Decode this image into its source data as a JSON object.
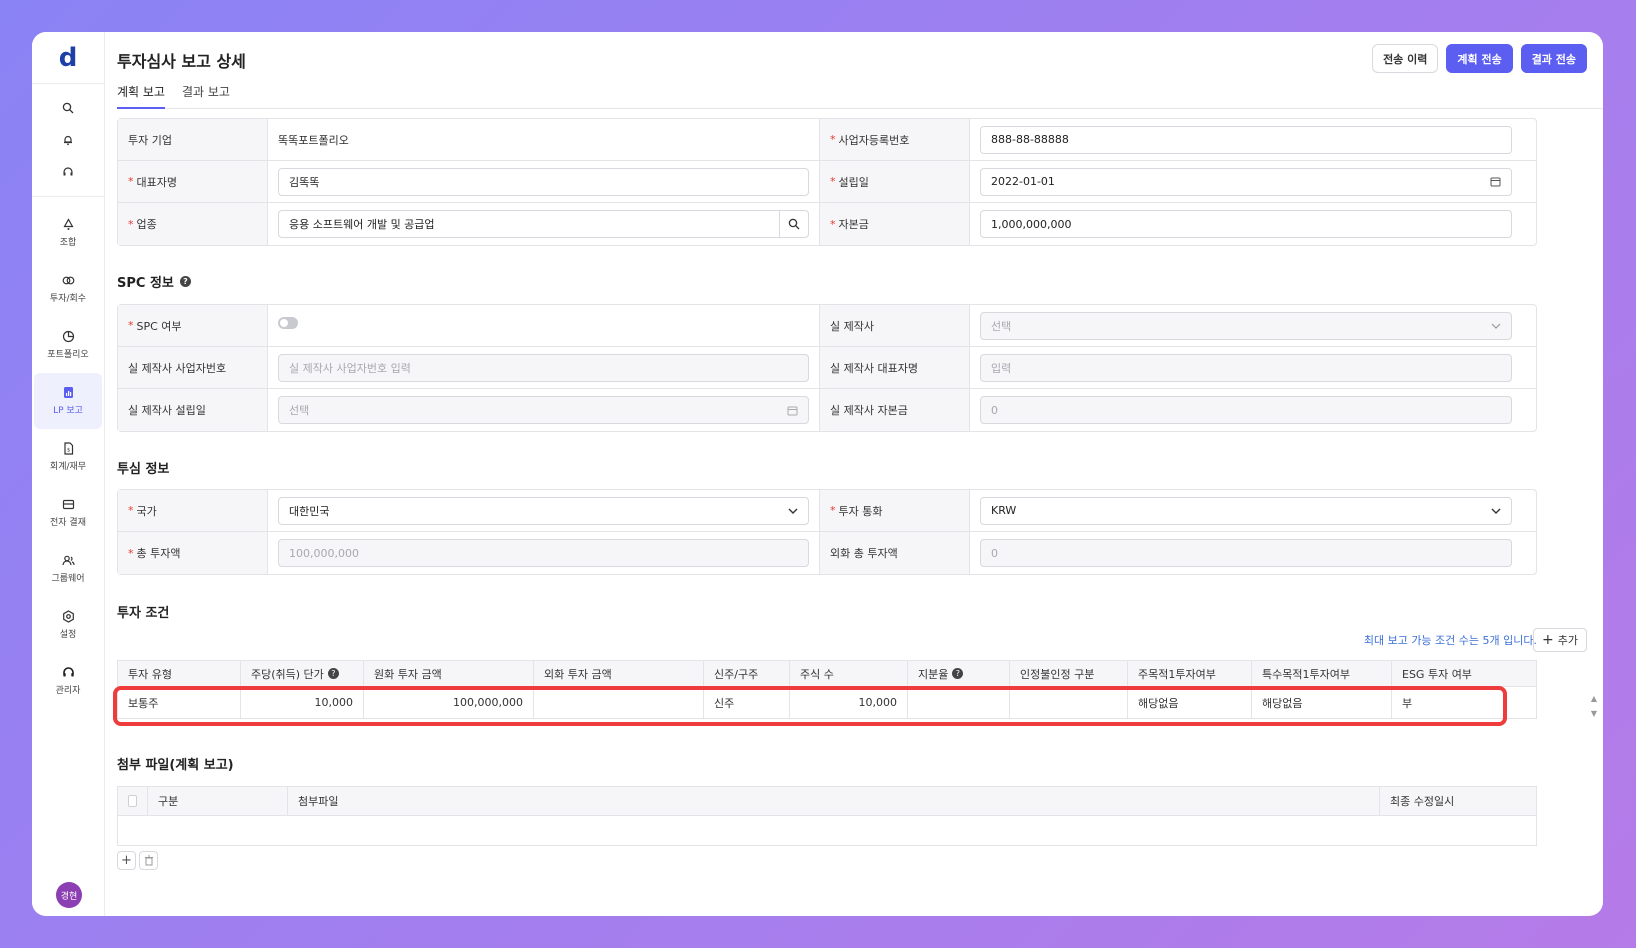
{
  "app": {
    "logo": "d",
    "title": "투자심사 보고 상세",
    "avatar": "경현"
  },
  "sidebar": {
    "top_icons": [
      "search-icon",
      "bell-icon",
      "headset-icon"
    ],
    "items": [
      {
        "label": "조합",
        "icon": "recycle-icon"
      },
      {
        "label": "투자/회수",
        "icon": "coins-icon"
      },
      {
        "label": "포트폴리오",
        "icon": "pie-chart-icon"
      },
      {
        "label": "LP 보고",
        "icon": "report-icon",
        "active": true
      },
      {
        "label": "회계/재무",
        "icon": "file-icon"
      },
      {
        "label": "전자 결재",
        "icon": "mail-icon"
      },
      {
        "label": "그룹웨어",
        "icon": "users-icon"
      },
      {
        "label": "설정",
        "icon": "gear-icon"
      },
      {
        "label": "관리자",
        "icon": "headset-admin-icon"
      }
    ]
  },
  "header": {
    "btn_history": "전송 이력",
    "btn_plan_send": "계획 전송",
    "btn_result_send": "결과 전송"
  },
  "tabs": [
    {
      "label": "계획 보고",
      "active": true
    },
    {
      "label": "결과 보고",
      "active": false
    }
  ],
  "company": {
    "company_label": "투자 기업",
    "company_value": "똑똑포트폴리오",
    "bizno_label": "사업자등록번호",
    "bizno_value": "888-88-88888",
    "ceo_label": "대표자명",
    "ceo_value": "김똑똑",
    "founded_label": "설립일",
    "founded_value": "2022-01-01",
    "industry_label": "업종",
    "industry_value": "응용 소프트웨어 개발 및 공급업",
    "capital_label": "자본금",
    "capital_value": "1,000,000,000"
  },
  "spc": {
    "section_title": "SPC 정보",
    "spc_label": "SPC 여부",
    "spc_on": false,
    "maker_label": "실 제작사",
    "maker_placeholder": "선택",
    "maker_bizno_label": "실 제작사 사업자번호",
    "maker_bizno_placeholder": "실 제작사 사업자번호 입력",
    "maker_ceo_label": "실 제작사 대표자명",
    "maker_ceo_placeholder": "입력",
    "maker_founded_label": "실 제작사 설립일",
    "maker_founded_placeholder": "선택",
    "maker_capital_label": "실 제작사 자본금",
    "maker_capital_placeholder": "0"
  },
  "review": {
    "section_title": "투심 정보",
    "country_label": "국가",
    "country_value": "대한민국",
    "currency_label": "투자 통화",
    "currency_value": "KRW",
    "total_label": "총 투자액",
    "total_value": "100,000,000",
    "fx_total_label": "외화 총 투자액",
    "fx_total_value": "0"
  },
  "terms": {
    "section_title": "투자 조건",
    "note": "최대 보고 가능 조건 수는 5개 입니다.",
    "add_label": "추가",
    "columns": [
      "투자 유형",
      "주당(취득) 단가",
      "원화 투자 금액",
      "외화 투자 금액",
      "신주/구주",
      "주식 수",
      "지분율",
      "인정불인정 구분",
      "주목적1투자여부",
      "특수목적1투자여부",
      "ESG 투자 여부"
    ],
    "rows": [
      [
        "보통주",
        "10,000",
        "100,000,000",
        "",
        "신주",
        "10,000",
        "",
        "",
        "해당없음",
        "해당없음",
        "부"
      ]
    ]
  },
  "attachments": {
    "section_title": "첨부 파일(계획 보고)",
    "columns": [
      "구분",
      "첨부파일",
      "최종 수정일시"
    ]
  }
}
